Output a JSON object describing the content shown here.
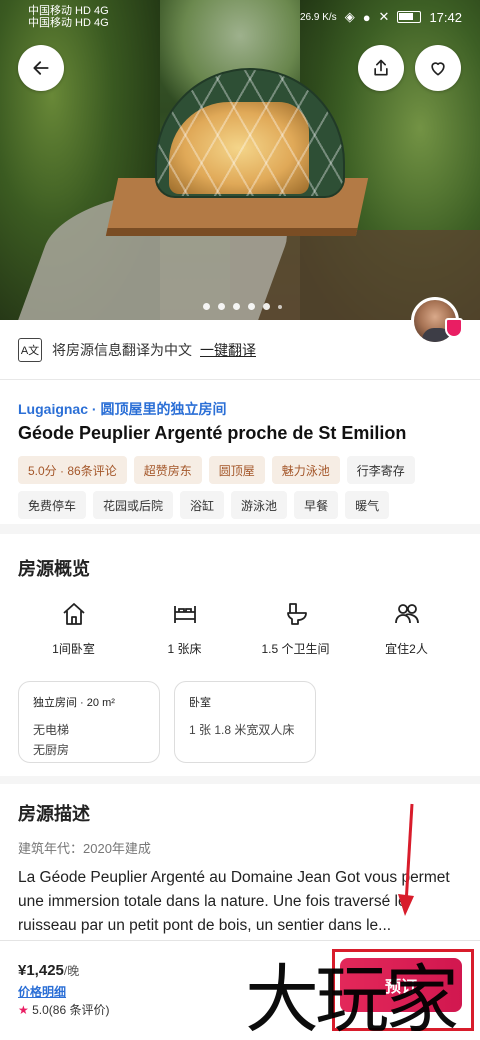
{
  "status": {
    "carrier1": "中国移动 HD 4G",
    "carrier2": "中国移动 HD 4G",
    "speed": "26.9 K/s",
    "time": "17:42"
  },
  "hero": {
    "photo_count_dots": 5
  },
  "translate": {
    "text": "将房源信息翻译为中文",
    "link": "一键翻译"
  },
  "listing": {
    "location": "Lugaignac · 圆顶屋里的独立房间",
    "title": "Géode Peuplier Argenté proche de St Emilion",
    "tags_highlight": [
      "5.0分 · 86条评论",
      "超赞房东",
      "圆顶屋",
      "魅力泳池"
    ],
    "tags_normal": [
      "行李寄存",
      "免费停车",
      "花园或后院",
      "浴缸",
      "游泳池",
      "早餐",
      "暖气"
    ]
  },
  "overview": {
    "title": "房源概览",
    "amenities": [
      {
        "icon": "house-icon",
        "label": "1间卧室"
      },
      {
        "icon": "bed-icon",
        "label": "1 张床"
      },
      {
        "icon": "toilet-icon",
        "label": "1.5 个卫生间"
      },
      {
        "icon": "guests-icon",
        "label": "宜住2人"
      }
    ],
    "card1": {
      "title": "独立房间 · 20 m²",
      "lines": [
        "无电梯",
        "无厨房"
      ]
    },
    "card2": {
      "title": "卧室",
      "lines": [
        "1 张 1.8 米宽双人床"
      ]
    }
  },
  "description": {
    "title": "房源描述",
    "meta": "建筑年代：2020年建成",
    "text": "La Géode Peuplier Argenté au Domaine Jean Got vous permet une immersion totale dans la nature. Une fois traversé le ruisseau par un petit pont de bois, un sentier dans le..."
  },
  "bottom": {
    "price": "¥1,425",
    "per": "/晚",
    "price_detail": "价格明细",
    "rating_star": "★",
    "rating": "5.0(86 条评价)",
    "book_label": "预订"
  },
  "watermark": "大玩家",
  "colors": {
    "accent": "#e3285a",
    "link": "#2b6fd6",
    "tag_highlight_bg": "#f6ede4",
    "tag_highlight_text": "#a4572a"
  }
}
